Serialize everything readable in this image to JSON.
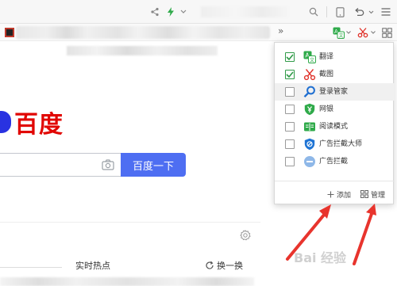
{
  "extensions_panel": {
    "items": [
      {
        "label": "翻译",
        "checked": true,
        "icon": "translate-icon"
      },
      {
        "label": "截图",
        "checked": true,
        "icon": "scissors-icon"
      },
      {
        "label": "登录管家",
        "checked": false,
        "icon": "key-search-icon"
      },
      {
        "label": "网银",
        "checked": false,
        "icon": "shield-yen-icon"
      },
      {
        "label": "阅读模式",
        "checked": false,
        "icon": "book-icon"
      },
      {
        "label": "广告拦截大师",
        "checked": false,
        "icon": "shield-block-icon"
      },
      {
        "label": "广告拦截",
        "checked": false,
        "icon": "minus-circle-icon"
      }
    ],
    "add_label": "添加",
    "manage_label": "管理"
  },
  "toolbar": {
    "more_label": "»"
  },
  "main": {
    "logo_text": "百度",
    "search_button": "百度一下",
    "hot_title": "实时热点",
    "refresh_label": "换一换"
  },
  "watermark_text": "Bai 经验",
  "colors": {
    "accent": "#4e6ef2",
    "logo_red": "#e10602",
    "logo_blue": "#2932e1",
    "check_green": "#2f9a47",
    "arrow_red": "#e8342d"
  }
}
